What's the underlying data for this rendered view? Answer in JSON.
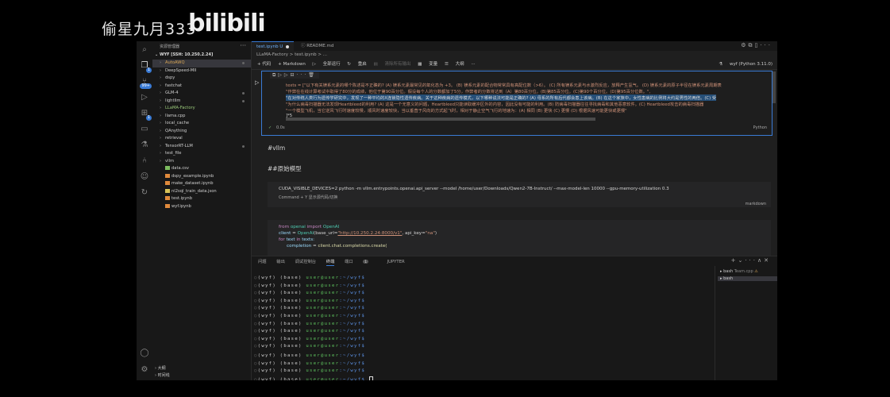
{
  "overlay": {
    "title": "偷星九月333",
    "logo": "bilibili"
  },
  "explorer": {
    "title": "资源管理器",
    "more": "···",
    "root": "WYF [SSH: 10.250.2.24]",
    "items": [
      {
        "label": "AutoAWQ",
        "kind": "folder",
        "color": "orange",
        "selected": true
      },
      {
        "label": "DeepSpeed-MII",
        "kind": "folder"
      },
      {
        "label": "dspy",
        "kind": "folder"
      },
      {
        "label": "fastchat",
        "kind": "folder"
      },
      {
        "label": "GLM-4",
        "kind": "folder"
      },
      {
        "label": "lightllm",
        "kind": "folder"
      },
      {
        "label": "LLaMA-Factory",
        "kind": "folder",
        "color": "green"
      },
      {
        "label": "llama.cpp",
        "kind": "folder"
      },
      {
        "label": "local_cache",
        "kind": "folder"
      },
      {
        "label": "QAnything",
        "kind": "folder"
      },
      {
        "label": "retrieval",
        "kind": "folder"
      },
      {
        "label": "TensorRT-LLM",
        "kind": "folder"
      },
      {
        "label": "test_file",
        "kind": "folder"
      },
      {
        "label": "vllm",
        "kind": "folder"
      },
      {
        "label": "data.csv",
        "kind": "file"
      },
      {
        "label": "dspy_example.ipynb",
        "kind": "file"
      },
      {
        "label": "make_dataset.ipynb",
        "kind": "file"
      },
      {
        "label": "nl2sql_train_data.json",
        "kind": "file"
      },
      {
        "label": "test.ipynb",
        "kind": "file"
      },
      {
        "label": "wyf.ipynb",
        "kind": "file"
      }
    ],
    "footer": [
      "大纲",
      "时间线"
    ]
  },
  "editor": {
    "tabs": [
      {
        "label": "test.ipynb U"
      },
      {
        "label": "README.md"
      }
    ],
    "breadcrumb": "LLaMA-Factory > test.ipynb > ...",
    "toolbar": {
      "code": "+ 代码",
      "markdown": "+ Markdown",
      "run_all": "全部运行",
      "restart": "重启",
      "clear": "清除所有输出",
      "variables": "变量",
      "outline": "大纲",
      "more": "···",
      "kernel": "wyf (Python 3.11.0)"
    },
    "cell1": {
      "lines": [
        "texts = [\"以下有关镁系元素的哪个陈述是不正确的? (A) 镁系元素最常见的氧化态为 +3。 (B) 镁系元素的配合物常常具有高配位数（>6）。 (C) 所有镁系元素与水激烈反应，放释产生氢气。 (D) 镁系元素的原子半径在镁系元素周期表",
        "\"作弊在在线计算考试中取得了80分的成绩，他位于第90百分位。假设每个人的分数都加了5分，作弊者的分数将达到（A）第80百分位。(B)第85百分位。(C)第90个百分位。(D)第95百分位数。\",",
        "\"在对传统人类行为遗传学研究中，发现了一种平均的X连锁隐性遗传疾病。关于这种疾病的遗传模式，以下哪种说法可能是正确的? (A) 母系的所有后代都会患上该病。(B) 在这个家族中，女性患病的比例将大约是男性的两倍。(C) 受",
        "\"为什么病毒扫描器无法发现Heartbleed的利用? (A) 这是一个无意义的问题，Heartbleed只能读取缓冲区外的内容，因此没有可能的利用。(B) 防病毒扫描器往往寻找病毒和其他恶意软件。(C) Heartbleed攻击的病毒扫描器",
        "\"一个模型飞机，当它逆风飞行时速度较慢，顺风时速度较快，当以垂直于风向的方式起飞时，相对于静止空气飞行的地速为：(A) 相同 (B) 更快 (C) 更慢 (D) 根据风速可能更快或更慢\"",
        "]*5"
      ],
      "status_time": "0.0s",
      "language": "Python"
    },
    "md_vllm": "#vllm",
    "md_model": "##原始模型",
    "cell2": {
      "command": "CUDA_VISIBLE_DEVICES=2 python -m vllm.entrypoints.openai.api_server --model /home/user/Downloads/Qwen2-7B-Instruct/ --max-model-len 10000 --gpu-memory-utilization 0.3",
      "meta": "Command + Y 显示源代码/切换",
      "language": "markdown"
    },
    "cell3": {
      "line1": {
        "from": "from",
        "module": "openai",
        "import": "import",
        "name": "OpenAI"
      },
      "line2": {
        "var": "client",
        "eq": " = ",
        "cls": "OpenAI",
        "arg1": "(base_url=",
        "url": "\"http://10.250.2.24:8000/v1\"",
        "arg2": ", api_key=",
        "key": "\"na\"",
        "end": ")"
      },
      "line3": {
        "for": "for",
        "var": " text ",
        "in": "in",
        "iter": " texts:"
      },
      "line4": {
        "var": "completion",
        "eq": " = ",
        "call": "client.chat.completions.create("
      }
    }
  },
  "panel": {
    "tabs": [
      "问题",
      "输出",
      "调试控制台",
      "终端",
      "端口",
      "JUPYTER"
    ],
    "port_count": "1",
    "active_tab": "终端",
    "terminal_prompt": {
      "env": "(wyf) (base)",
      "user": "user@user",
      "path": ":~/wyf$"
    },
    "terminal_lines": 14,
    "terminals": [
      {
        "label": "bash",
        "sub": "Team.cpp"
      },
      {
        "label": "bash",
        "sub": ""
      }
    ]
  }
}
